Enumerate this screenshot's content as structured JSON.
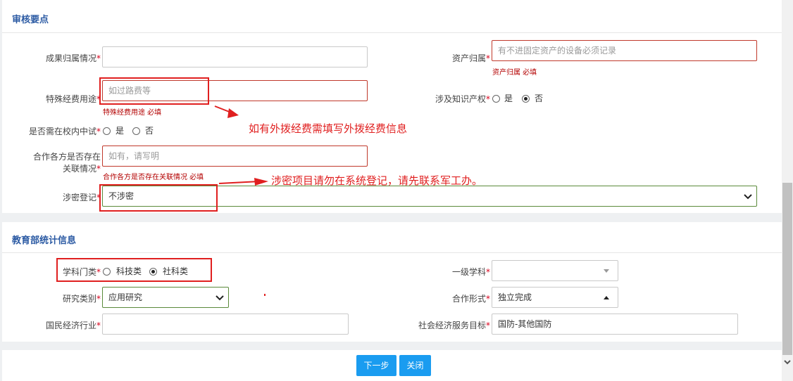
{
  "sections": {
    "review": "审核要点",
    "moe": "教育部统计信息"
  },
  "review": {
    "result_owner": {
      "label": "成果归属情况",
      "value": ""
    },
    "asset_owner": {
      "label": "资产归属",
      "placeholder": "有不进固定资产的设备必须记录",
      "error": "资产归属 必填"
    },
    "special_use": {
      "label": "特殊经费用途",
      "placeholder": "如过路费等",
      "error": "特殊经费用途 必填"
    },
    "ip": {
      "label": "涉及知识产权",
      "yes": "是",
      "no": "否",
      "selected": "否"
    },
    "trial": {
      "label": "是否需在校内中试",
      "yes": "是",
      "no": "否",
      "selected": ""
    },
    "partner": {
      "label_line1": "合作各方是否存在",
      "label_line2": "关联情况",
      "placeholder": "如有，请写明",
      "error": "合作各方是否存在关联情况 必填"
    },
    "secret": {
      "label": "涉密登记",
      "value": "不涉密"
    }
  },
  "annotations": {
    "outside_funds": "如有外拨经费需填写外拨经费信息",
    "secret_note": "涉密项目请勿在系统登记，请先联系军工办。"
  },
  "moe": {
    "subject_type": {
      "label": "学科门类",
      "opt1": "科技类",
      "opt2": "社科类",
      "selected": "社科类"
    },
    "first_subject": {
      "label": "一级学科",
      "value": ""
    },
    "research_type": {
      "label": "研究类别",
      "value": "应用研究"
    },
    "coop_form": {
      "label": "合作形式",
      "value": "独立完成"
    },
    "industry": {
      "label": "国民经济行业",
      "value": ""
    },
    "service_goal": {
      "label": "社会经济服务目标",
      "value": "国防-其他国防"
    }
  },
  "buttons": {
    "next": "下一步",
    "close": "关闭"
  },
  "colors": {
    "accent": "#1a9cf0",
    "title": "#2b5aa3",
    "error": "#c0392b",
    "annotation": "#e01f1f"
  }
}
